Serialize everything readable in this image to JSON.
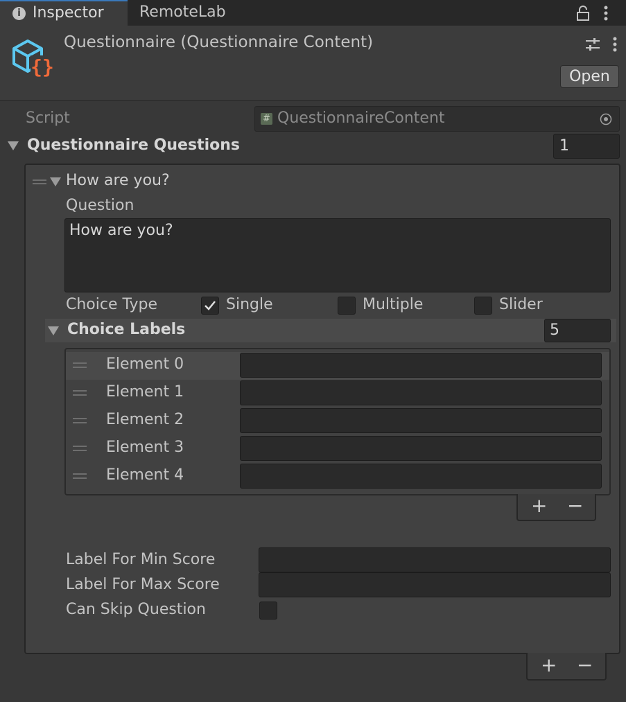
{
  "tabs": {
    "inspector": "Inspector",
    "remotelab": "RemoteLab"
  },
  "header": {
    "title": "Questionnaire (Questionnaire Content)",
    "open_label": "Open"
  },
  "script": {
    "label": "Script",
    "value": "QuestionnaireContent"
  },
  "questions": {
    "label": "Questionnaire Questions",
    "count": "1",
    "element_title": "How are you?",
    "question_label": "Question",
    "question_value": "How are you?",
    "choice_type_label": "Choice Type",
    "choice_options": [
      {
        "label": "Single",
        "checked": true
      },
      {
        "label": "Multiple",
        "checked": false
      },
      {
        "label": "Slider",
        "checked": false
      }
    ],
    "choice_labels": {
      "label": "Choice Labels",
      "count": "5",
      "elements": [
        "Element 0",
        "Element 1",
        "Element 2",
        "Element 3",
        "Element 4"
      ]
    },
    "min_score_label": "Label For Min Score",
    "max_score_label": "Label For Max Score",
    "can_skip_label": "Can Skip Question"
  },
  "buttons": {
    "plus": "+",
    "minus": "−"
  },
  "icons": {
    "tab_info": "info-icon",
    "lock": "lock-icon",
    "menu": "kebab-menu-icon",
    "asset": "scriptable-object-icon",
    "settings": "sliders-icon",
    "picker": "object-picker-icon",
    "drag": "drag-handle-icon",
    "check": "checkmark-icon"
  },
  "colors": {
    "accent": "#3a79bb",
    "asset_cube": "#5cc8f0",
    "asset_braces": "#f06a3a"
  }
}
